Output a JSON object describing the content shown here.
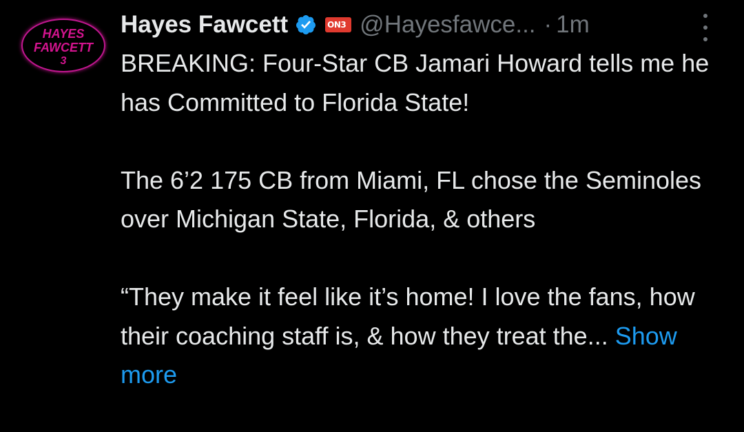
{
  "avatar": {
    "line1": "HAYES",
    "line2": "FAWCETT",
    "line3": "3",
    "ring_color": "#c0178f",
    "text_color": "#d4148f"
  },
  "author": {
    "display_name": "Hayes Fawcett",
    "verified_icon": "verified-badge-icon",
    "affiliate_badge": "ON3",
    "handle": "@Hayesfawce...",
    "separator": "·",
    "time": "1m"
  },
  "tweet": {
    "para1": "BREAKING: Four-Star CB Jamari Howard tells me he has Committed to Florida State!",
    "para2": "The 6’2 175 CB from Miami, FL chose the Seminoles over Michigan State, Florida, & others",
    "para3": "“They make it feel like it’s home! I love the fans, how their coaching staff is, & how they treat the...",
    "show_more": "Show more"
  },
  "colors": {
    "background": "#000000",
    "primary_text": "#e7e9ea",
    "secondary_text": "#71767b",
    "link": "#1d9bf0",
    "verified": "#1d9bf0",
    "affiliate": "#e03a2f"
  }
}
